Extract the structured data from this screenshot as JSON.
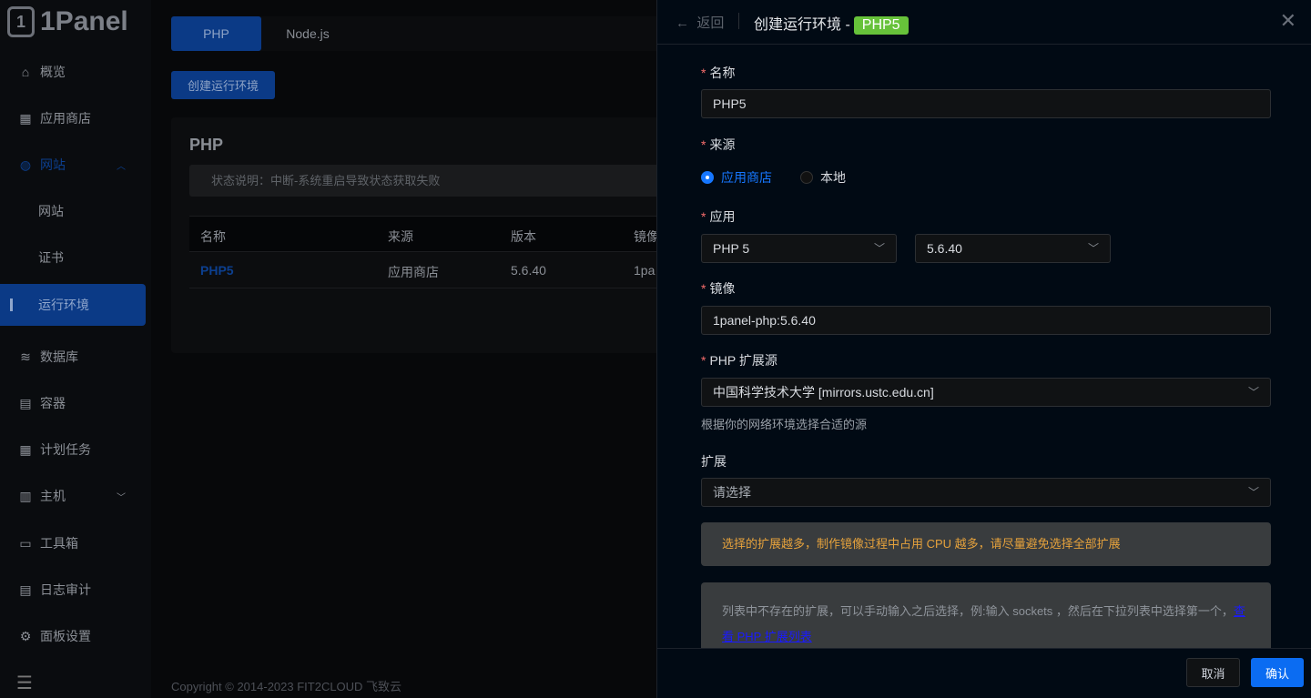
{
  "logo": {
    "text": "1Panel",
    "mark": "1"
  },
  "sidebar": {
    "items": [
      {
        "label": "概览",
        "icon": "home-icon"
      },
      {
        "label": "应用商店",
        "icon": "grid-icon"
      },
      {
        "label": "网站",
        "icon": "globe-icon"
      },
      {
        "label": "网站"
      },
      {
        "label": "证书"
      },
      {
        "label": "运行环境"
      },
      {
        "label": "数据库",
        "icon": "layers-icon"
      },
      {
        "label": "容器",
        "icon": "docker-icon"
      },
      {
        "label": "计划任务",
        "icon": "calendar-icon"
      },
      {
        "label": "主机",
        "icon": "server-icon"
      },
      {
        "label": "工具箱",
        "icon": "toolbox-icon"
      },
      {
        "label": "日志审计",
        "icon": "log-icon"
      },
      {
        "label": "面板设置",
        "icon": "gear-icon"
      }
    ]
  },
  "main": {
    "tabs": [
      "PHP",
      "Node.js"
    ],
    "create_button": "创建运行环境",
    "card_title": "PHP",
    "status_note": "状态说明：中断-系统重启导致状态获取失败",
    "columns": [
      "名称",
      "来源",
      "版本",
      "镜像"
    ],
    "rows": [
      {
        "name": "PHP5",
        "source": "应用商店",
        "version": "5.6.40",
        "image": "1pa"
      }
    ],
    "copyright": "Copyright © 2014-2023 FIT2CLOUD 飞致云"
  },
  "drawer": {
    "back": "返回",
    "title": "创建运行环境 -",
    "badge": "PHP5",
    "name_label": "名称",
    "name_value": "PHP5",
    "source_label": "来源",
    "source_options": [
      "应用商店",
      "本地"
    ],
    "app_label": "应用",
    "app_value": "PHP 5",
    "version_value": "5.6.40",
    "image_label": "镜像",
    "image_value": "1panel-php:5.6.40",
    "ext_source_label": "PHP 扩展源",
    "ext_source_value": "中国科学技术大学 [mirrors.ustc.edu.cn]",
    "ext_source_hint": "根据你的网络环境选择合适的源",
    "ext_label": "扩展",
    "ext_placeholder": "请选择",
    "warning": "选择的扩展越多，制作镜像过程中占用 CPU 越多，请尽量避免选择全部扩展",
    "info": "列表中不存在的扩展，可以手动输入之后选择，例:输入 sockets ，然后在下拉列表中选择第一个，",
    "info_link": "查看 PHP 扩展列表",
    "cancel": "取消",
    "confirm": "确认"
  }
}
